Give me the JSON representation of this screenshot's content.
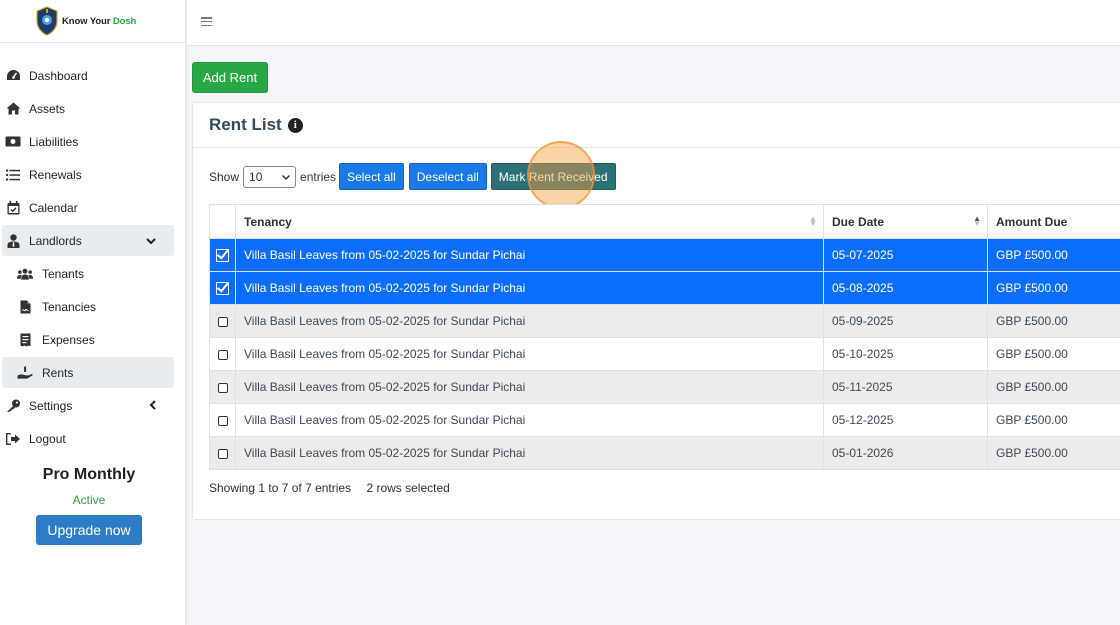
{
  "brand": {
    "name_part1": "Know Your ",
    "name_part2": "Dosh"
  },
  "sidebar": {
    "items": [
      {
        "label": "Dashboard",
        "icon": "dashboard-icon"
      },
      {
        "label": "Assets",
        "icon": "home-icon"
      },
      {
        "label": "Liabilities",
        "icon": "money-icon"
      },
      {
        "label": "Renewals",
        "icon": "list-icon"
      },
      {
        "label": "Calendar",
        "icon": "calendar-icon"
      },
      {
        "label": "Landlords",
        "icon": "user-tie-icon"
      },
      {
        "label": "Tenants",
        "icon": "users-icon"
      },
      {
        "label": "Tenancies",
        "icon": "contract-icon"
      },
      {
        "label": "Expenses",
        "icon": "receipt-icon"
      },
      {
        "label": "Rents",
        "icon": "hand-money-icon"
      },
      {
        "label": "Settings",
        "icon": "key-icon"
      },
      {
        "label": "Logout",
        "icon": "logout-icon"
      }
    ],
    "plan": {
      "title": "Pro Monthly",
      "status": "Active",
      "upgrade_label": "Upgrade now"
    }
  },
  "main": {
    "add_button": "Add Rent",
    "card_title": "Rent List",
    "info_icon": "i",
    "show_label": "Show",
    "entries_label": "entries",
    "page_size": "10",
    "select_all": "Select all",
    "deselect_all": "Deselect all",
    "mark_received": "Mark Rent Received",
    "table": {
      "columns": [
        "Tenancy",
        "Due Date",
        "Amount Due"
      ],
      "rows": [
        {
          "tenancy": "Villa Basil Leaves from 05-02-2025 for Sundar Pichai",
          "due": "05-07-2025",
          "amount": "GBP £500.00",
          "selected": true
        },
        {
          "tenancy": "Villa Basil Leaves from 05-02-2025 for Sundar Pichai",
          "due": "05-08-2025",
          "amount": "GBP £500.00",
          "selected": true
        },
        {
          "tenancy": "Villa Basil Leaves from 05-02-2025 for Sundar Pichai",
          "due": "05-09-2025",
          "amount": "GBP £500.00",
          "selected": false
        },
        {
          "tenancy": "Villa Basil Leaves from 05-02-2025 for Sundar Pichai",
          "due": "05-10-2025",
          "amount": "GBP £500.00",
          "selected": false
        },
        {
          "tenancy": "Villa Basil Leaves from 05-02-2025 for Sundar Pichai",
          "due": "05-11-2025",
          "amount": "GBP £500.00",
          "selected": false
        },
        {
          "tenancy": "Villa Basil Leaves from 05-02-2025 for Sundar Pichai",
          "due": "05-12-2025",
          "amount": "GBP £500.00",
          "selected": false
        },
        {
          "tenancy": "Villa Basil Leaves from 05-02-2025 for Sundar Pichai",
          "due": "05-01-2026",
          "amount": "GBP £500.00",
          "selected": false
        }
      ]
    },
    "info_text": "Showing 1 to 7 of 7 entries",
    "selected_text": "2 rows selected"
  },
  "colors": {
    "primary": "#0d6efd",
    "success": "#28a745",
    "teal": "#2c7078",
    "upgrade": "#2c7dc5"
  }
}
